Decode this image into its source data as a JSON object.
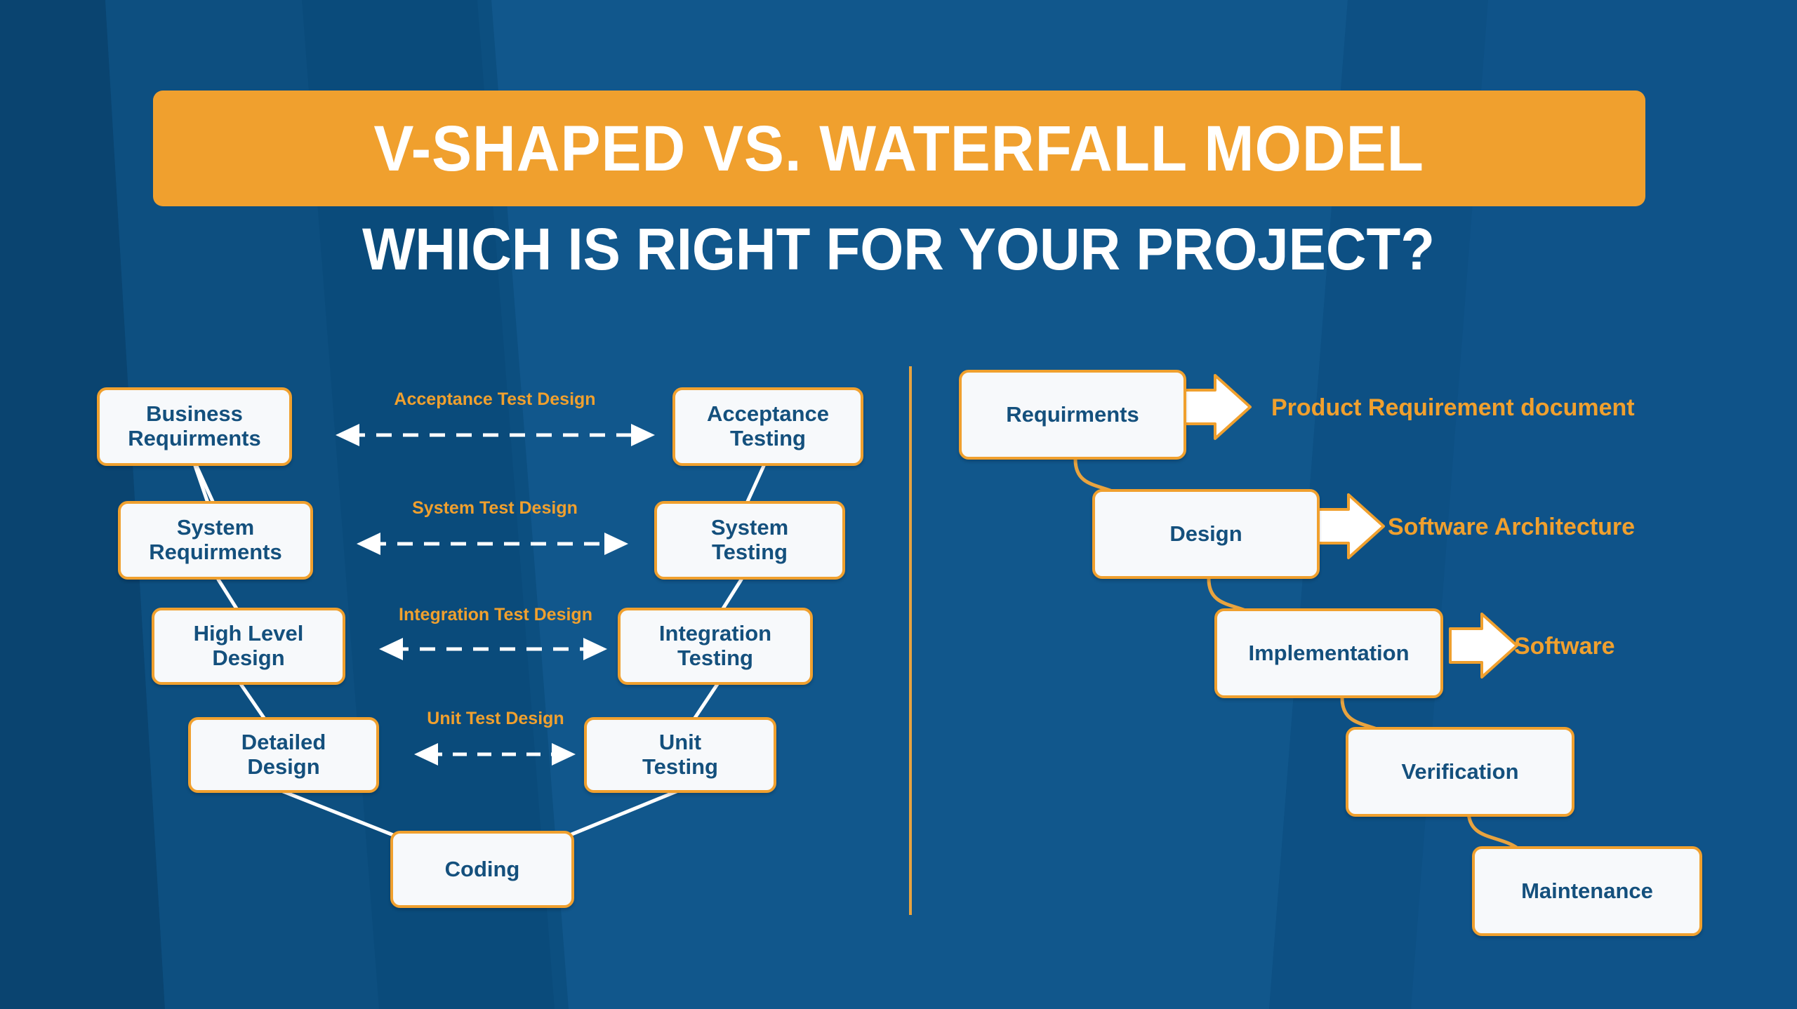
{
  "palette": {
    "background_blue": "#0d4f80",
    "band_dark": "#0a4470",
    "band_light": "#155e96",
    "accent_orange": "#f0a02e",
    "node_fill": "#f7f9fb",
    "node_text": "#14507d",
    "white": "#ffffff"
  },
  "header": {
    "title": "V-SHAPED VS. WATERFALL MODEL",
    "subtitle": "WHICH IS RIGHT FOR YOUR PROJECT?"
  },
  "v_model": {
    "left_stages": [
      {
        "id": "business-requirments",
        "line1": "Business",
        "line2": "Requirments"
      },
      {
        "id": "system-requirments",
        "line1": "System",
        "line2": "Requirments"
      },
      {
        "id": "high-level-design",
        "line1": "High Level",
        "line2": "Design"
      },
      {
        "id": "detailed-design",
        "line1": "Detailed",
        "line2": "Design"
      }
    ],
    "right_stages": [
      {
        "id": "acceptance-testing",
        "line1": "Acceptance",
        "line2": "Testing"
      },
      {
        "id": "system-testing",
        "line1": "System",
        "line2": "Testing"
      },
      {
        "id": "integration-testing",
        "line1": "Integration",
        "line2": "Testing"
      },
      {
        "id": "unit-testing",
        "line1": "Unit",
        "line2": "Testing"
      }
    ],
    "bottom_stage": {
      "id": "coding",
      "line1": "Coding"
    },
    "connector_labels": [
      "Acceptance Test Design",
      "System Test Design",
      "Integration Test Design",
      "Unit Test Design"
    ]
  },
  "waterfall_model": {
    "stages": [
      {
        "id": "requirments",
        "label": "Requirments",
        "deliverable": "Product Requirement document"
      },
      {
        "id": "design",
        "label": "Design",
        "deliverable": "Software Architecture"
      },
      {
        "id": "implementation",
        "label": "Implementation",
        "deliverable": "Software"
      },
      {
        "id": "verification",
        "label": "Verification",
        "deliverable": ""
      },
      {
        "id": "maintenance",
        "label": "Maintenance",
        "deliverable": ""
      }
    ]
  }
}
